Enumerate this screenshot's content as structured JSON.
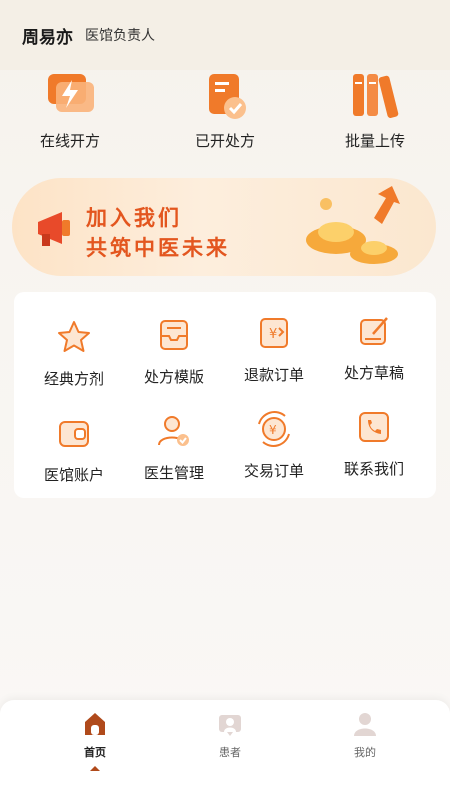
{
  "header": {
    "name": "周易亦",
    "role": "医馆负责人"
  },
  "quick_actions": [
    {
      "label": "在线开方",
      "icon": "lightning-chat-icon"
    },
    {
      "label": "已开处方",
      "icon": "prescription-check-icon"
    },
    {
      "label": "批量上传",
      "icon": "books-icon"
    }
  ],
  "banner": {
    "line1": "加入我们",
    "line2": "共筑中医未来"
  },
  "grid": [
    {
      "label": "经典方剂",
      "icon": "star-icon"
    },
    {
      "label": "处方模版",
      "icon": "template-icon"
    },
    {
      "label": "退款订单",
      "icon": "refund-icon"
    },
    {
      "label": "处方草稿",
      "icon": "draft-icon"
    },
    {
      "label": "医馆账户",
      "icon": "wallet-icon"
    },
    {
      "label": "医生管理",
      "icon": "doctor-icon"
    },
    {
      "label": "交易订单",
      "icon": "trade-order-icon"
    },
    {
      "label": "联系我们",
      "icon": "phone-icon"
    }
  ],
  "tabbar": [
    {
      "label": "首页",
      "icon": "home-icon",
      "active": true
    },
    {
      "label": "患者",
      "icon": "patient-icon",
      "active": false
    },
    {
      "label": "我的",
      "icon": "profile-icon",
      "active": false
    }
  ],
  "colors": {
    "accent": "#f07a2a",
    "accent_dark": "#e3561f",
    "tab_active": "#b04a1b"
  }
}
